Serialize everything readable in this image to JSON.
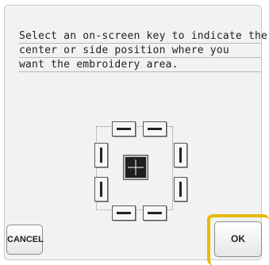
{
  "message": {
    "line1": "Select an on-screen key to indicate the",
    "line2": "center or side position where you",
    "line3": "want the embroidery area."
  },
  "buttons": {
    "cancel": "CANCEL",
    "ok": "OK"
  },
  "colors": {
    "highlight": "#e6bc00",
    "center_key": "#1f1f1f"
  },
  "position_keys": [
    "top-left-key",
    "top-right-key",
    "left-upper-key",
    "right-upper-key",
    "center-key",
    "left-lower-key",
    "right-lower-key",
    "bottom-left-key",
    "bottom-right-key"
  ]
}
